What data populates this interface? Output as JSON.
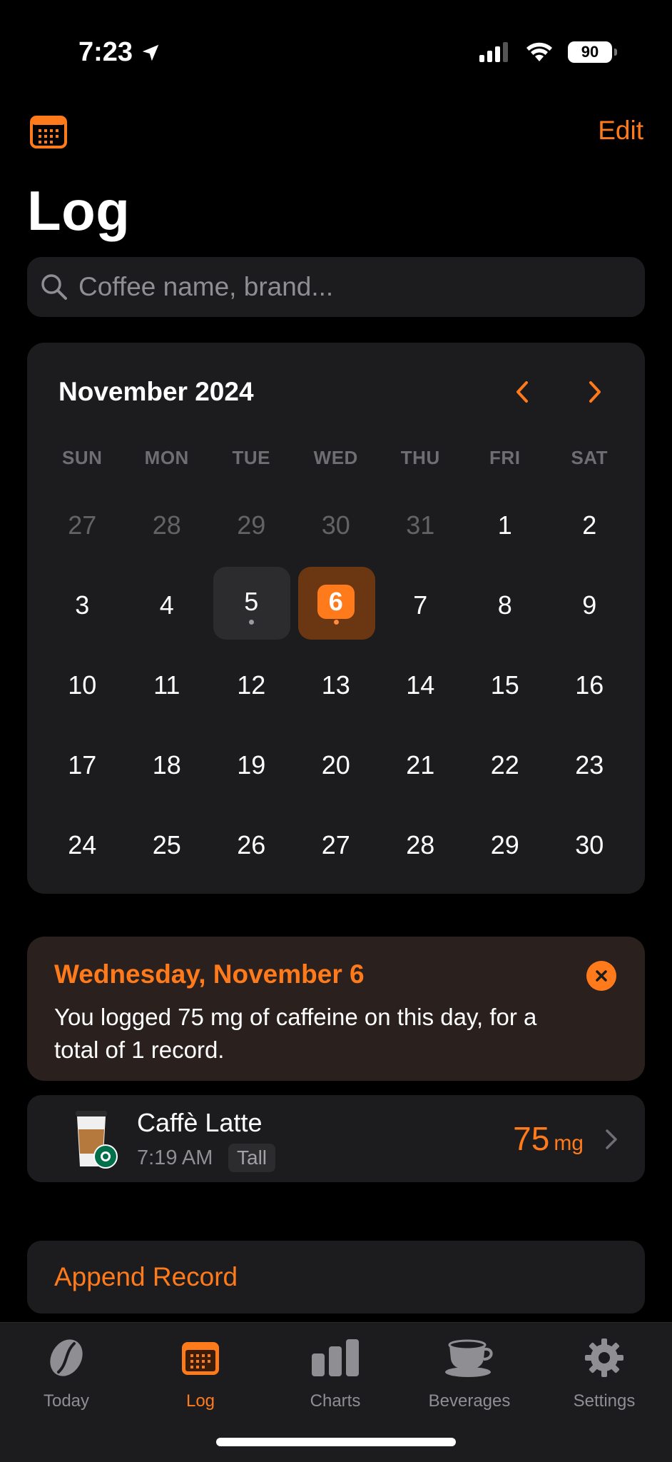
{
  "status": {
    "time": "7:23",
    "battery": "90"
  },
  "header": {
    "edit_label": "Edit",
    "title": "Log"
  },
  "search": {
    "placeholder": "Coffee name, brand..."
  },
  "calendar": {
    "month": "November 2024",
    "weekdays": [
      "SUN",
      "MON",
      "TUE",
      "WED",
      "THU",
      "FRI",
      "SAT"
    ],
    "weeks": [
      [
        "27",
        "28",
        "29",
        "30",
        "31",
        "1",
        "2"
      ],
      [
        "3",
        "4",
        "5",
        "6",
        "7",
        "8",
        "9"
      ],
      [
        "10",
        "11",
        "12",
        "13",
        "14",
        "15",
        "16"
      ],
      [
        "17",
        "18",
        "19",
        "20",
        "21",
        "22",
        "23"
      ],
      [
        "24",
        "25",
        "26",
        "27",
        "28",
        "29",
        "30"
      ]
    ],
    "selected_day": "6",
    "previous_day": "5"
  },
  "summary": {
    "title": "Wednesday, November 6",
    "text": "You logged 75 mg of caffeine on this day, for a total of 1 record."
  },
  "record": {
    "name": "Caffè Latte",
    "time": "7:19 AM",
    "size": "Tall",
    "amount": "75",
    "unit": "mg"
  },
  "append_label": "Append Record",
  "tabs": [
    {
      "label": "Today",
      "icon": "coffee-bean-icon"
    },
    {
      "label": "Log",
      "icon": "calendar-icon"
    },
    {
      "label": "Charts",
      "icon": "bar-chart-icon"
    },
    {
      "label": "Beverages",
      "icon": "coffee-cup-icon"
    },
    {
      "label": "Settings",
      "icon": "gear-icon"
    }
  ],
  "colors": {
    "accent": "#ff7a1a",
    "card": "#1c1c1e",
    "background": "#000000"
  }
}
